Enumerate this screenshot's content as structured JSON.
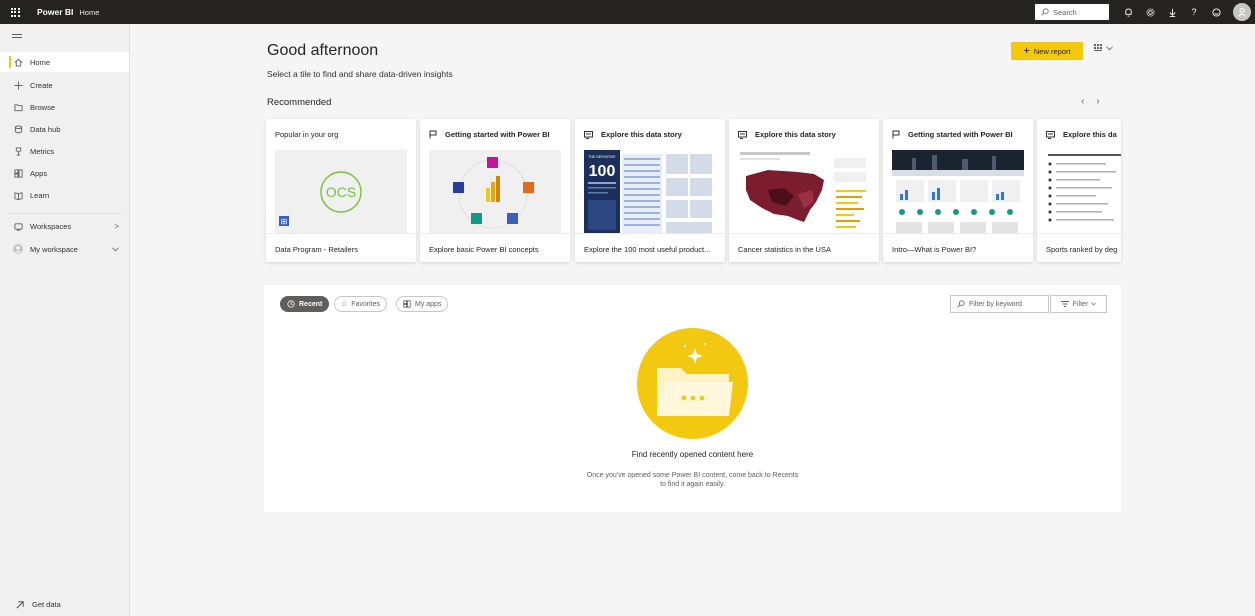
{
  "topbar": {
    "brand": "Power BI",
    "breadcrumb": "Home",
    "search_placeholder": "Search"
  },
  "sidebar": {
    "items": [
      {
        "label": "Home",
        "icon": "home-icon",
        "active": true
      },
      {
        "label": "Create",
        "icon": "plus-icon"
      },
      {
        "label": "Browse",
        "icon": "folder-icon"
      },
      {
        "label": "Data hub",
        "icon": "database-icon"
      },
      {
        "label": "Metrics",
        "icon": "trophy-icon"
      },
      {
        "label": "Apps",
        "icon": "apps-icon"
      },
      {
        "label": "Learn",
        "icon": "book-icon"
      },
      {
        "label": "Workspaces",
        "icon": "workspaces-icon",
        "chevron": ">"
      },
      {
        "label": "My workspace",
        "icon": "user-avatar-icon",
        "chevron": "v"
      }
    ],
    "get_data": "Get data"
  },
  "main": {
    "greeting": "Good afternoon",
    "subtitle": "Select a tile to find and share data-driven insights",
    "new_report": "New report",
    "recommended_title": "Recommended"
  },
  "recommended": [
    {
      "header": "Popular in your org",
      "footer": "Data Program - Retailers",
      "icon": "none"
    },
    {
      "header": "Getting started with Power BI",
      "footer": "Explore basic Power BI concepts",
      "icon": "flag-icon"
    },
    {
      "header": "Explore this data story",
      "footer": "Explore the 100 most useful product...",
      "icon": "story-icon"
    },
    {
      "header": "Explore this data story",
      "footer": "Cancer statistics in the USA",
      "icon": "story-icon"
    },
    {
      "header": "Getting started with Power BI",
      "footer": "Intro—What is Power BI?",
      "icon": "flag-icon"
    },
    {
      "header": "Explore this da",
      "footer": "Sports ranked by deg",
      "icon": "story-icon"
    }
  ],
  "thumb_text": {
    "ocs": "OCS",
    "big_number": "100",
    "the_definitive": "THE DEFINITIVE"
  },
  "recent_panel": {
    "tabs": [
      {
        "label": "Recent",
        "active": true
      },
      {
        "label": "Favorites"
      },
      {
        "label": "My apps"
      }
    ],
    "filter_placeholder": "Filter by keyword",
    "filter_button": "Filter",
    "empty_title": "Find recently opened content here",
    "empty_desc_line1": "Once you've opened some Power BI content, come back to Recents",
    "empty_desc_line2": "to find it again easily."
  },
  "colors": {
    "accent": "#f2c811",
    "topbar": "#252423",
    "sidebar": "#f0f0f0"
  }
}
